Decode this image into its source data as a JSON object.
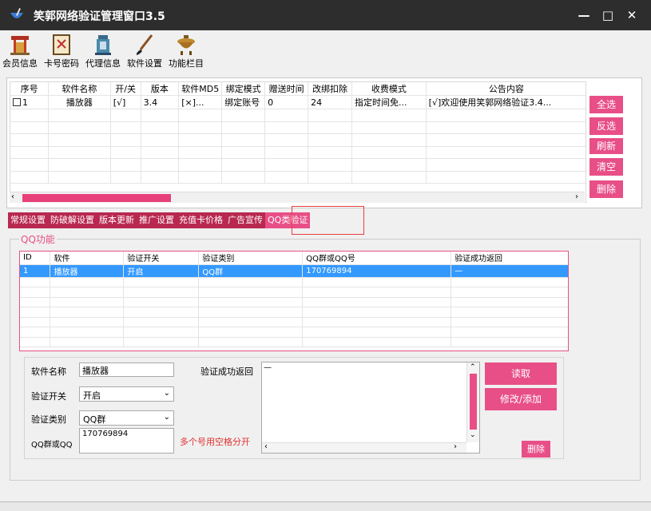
{
  "window": {
    "title": "笑郭网络验证管理窗口3.5",
    "minimize": "—",
    "maximize": "□",
    "close": "✕"
  },
  "toolbar": {
    "items": [
      {
        "label": "会员信息",
        "icon": "temple-gate-icon"
      },
      {
        "label": "卡号密码",
        "icon": "scroll-painting-icon"
      },
      {
        "label": "代理信息",
        "icon": "scripture-tablet-icon"
      },
      {
        "label": "软件设置",
        "icon": "brush-icon"
      },
      {
        "label": "功能栏目",
        "icon": "incense-burner-icon"
      }
    ]
  },
  "software_table": {
    "columns": [
      "序号",
      "软件名称",
      "开/关",
      "版本",
      "软件MD5",
      "绑定模式",
      "赠送时间",
      "改绑扣除",
      "收费模式",
      "公告内容"
    ],
    "rows": [
      [
        "1",
        "播放器",
        "[√]",
        "3.4",
        "[×]...",
        "绑定账号",
        "0",
        "24",
        "指定时间免...",
        "[√]欢迎使用笑郭网络验证3.4..."
      ]
    ]
  },
  "side_buttons": [
    "全选",
    "反选",
    "刷新",
    "清空",
    "删除"
  ],
  "tabs": [
    "常规设置",
    "防破解设置",
    "版本更新",
    "推广设置",
    "充值卡价格",
    "广告宣传",
    "QQ类验证"
  ],
  "qq": {
    "group_title": "QQ功能",
    "columns": [
      "ID",
      "软件",
      "验证开关",
      "验证类别",
      "QQ群或QQ号",
      "验证成功返回"
    ],
    "rows": [
      [
        "1",
        "播放器",
        "开启",
        "QQ群",
        "170769894",
        "—"
      ]
    ]
  },
  "form": {
    "software_name_label": "软件名称",
    "software_name_value": "播放器",
    "switch_label": "验证开关",
    "switch_value": "开启",
    "type_label": "验证类别",
    "type_value": "QQ群",
    "qq_label": "QQ群或QQ",
    "qq_value": "170769894",
    "hint": "多个号用空格分开",
    "return_label": "验证成功返回",
    "return_value": "—",
    "read_button": "读取",
    "modify_button": "修改/添加",
    "delete_button": "删除"
  },
  "colors": {
    "accent": "#e84f87",
    "tab_bg": "#b8284f",
    "selection": "#3399ff",
    "titlebar": "#2d2d2d",
    "hint": "#e03030"
  }
}
